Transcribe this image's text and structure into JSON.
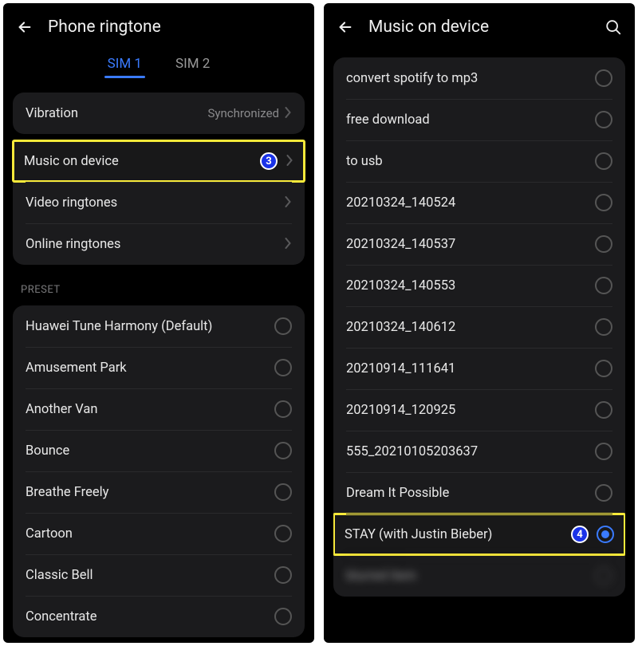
{
  "left": {
    "title": "Phone ringtone",
    "tabs": [
      "SIM 1",
      "SIM 2"
    ],
    "activeTab": 0,
    "vibration": {
      "label": "Vibration",
      "value": "Synchronized"
    },
    "sourceItems": [
      {
        "label": "Music on device",
        "highlighted": true,
        "badge": "3"
      },
      {
        "label": "Video ringtones"
      },
      {
        "label": "Online ringtones"
      }
    ],
    "presetHeader": "PRESET",
    "presets": [
      "Huawei Tune Harmony (Default)",
      "Amusement Park",
      "Another Van",
      "Bounce",
      "Breathe Freely",
      "Cartoon",
      "Classic Bell",
      "Concentrate"
    ]
  },
  "right": {
    "title": "Music on device",
    "items": [
      {
        "label": "convert spotify to mp3"
      },
      {
        "label": "free download"
      },
      {
        "label": "to usb"
      },
      {
        "label": "20210324_140524"
      },
      {
        "label": "20210324_140537"
      },
      {
        "label": "20210324_140553"
      },
      {
        "label": "20210324_140612"
      },
      {
        "label": "20210914_111641"
      },
      {
        "label": "20210914_120925"
      },
      {
        "label": "555_20210105203637"
      },
      {
        "label": "Dream It Possible"
      },
      {
        "label": "STAY (with Justin Bieber)",
        "selected": true,
        "highlighted": true,
        "badge": "4"
      },
      {
        "label": "blurred item",
        "blurred": true
      }
    ]
  }
}
